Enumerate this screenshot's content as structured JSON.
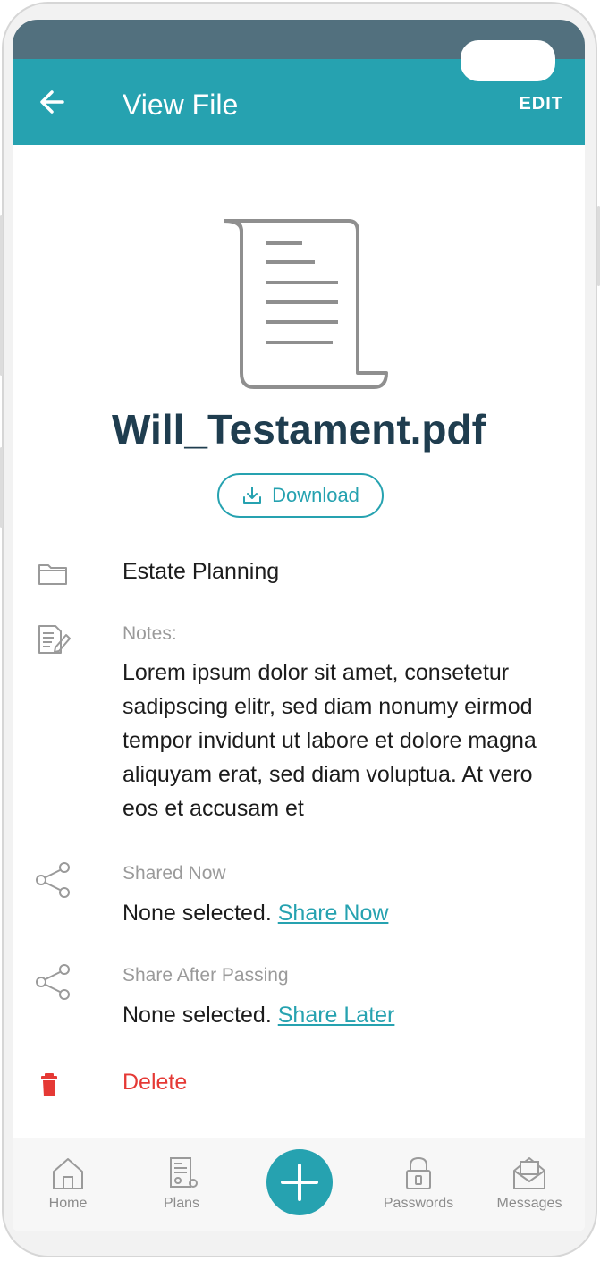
{
  "header": {
    "title": "View File",
    "edit_label": "EDIT"
  },
  "file": {
    "name": "Will_Testament.pdf",
    "download_label": "Download",
    "folder": "Estate Planning",
    "notes_label": "Notes:",
    "notes_text": "Lorem ipsum dolor sit amet, consetetur sadipscing elitr, sed diam nonumy eirmod tempor invidunt ut labore et dolore magna aliquyam erat, sed diam voluptua. At vero eos et accusam et"
  },
  "sharing": {
    "now_label": "Shared Now",
    "now_value": "None selected.",
    "now_link": "Share Now",
    "after_label": "Share After Passing",
    "after_value": "None selected.",
    "after_link": "Share Later"
  },
  "delete_label": "Delete",
  "nav": {
    "home": "Home",
    "plans": "Plans",
    "passwords": "Passwords",
    "messages": "Messages"
  },
  "colors": {
    "accent": "#26a2b0",
    "status_bar": "#52707e",
    "title_text": "#1f3d4f",
    "danger": "#e53935"
  }
}
